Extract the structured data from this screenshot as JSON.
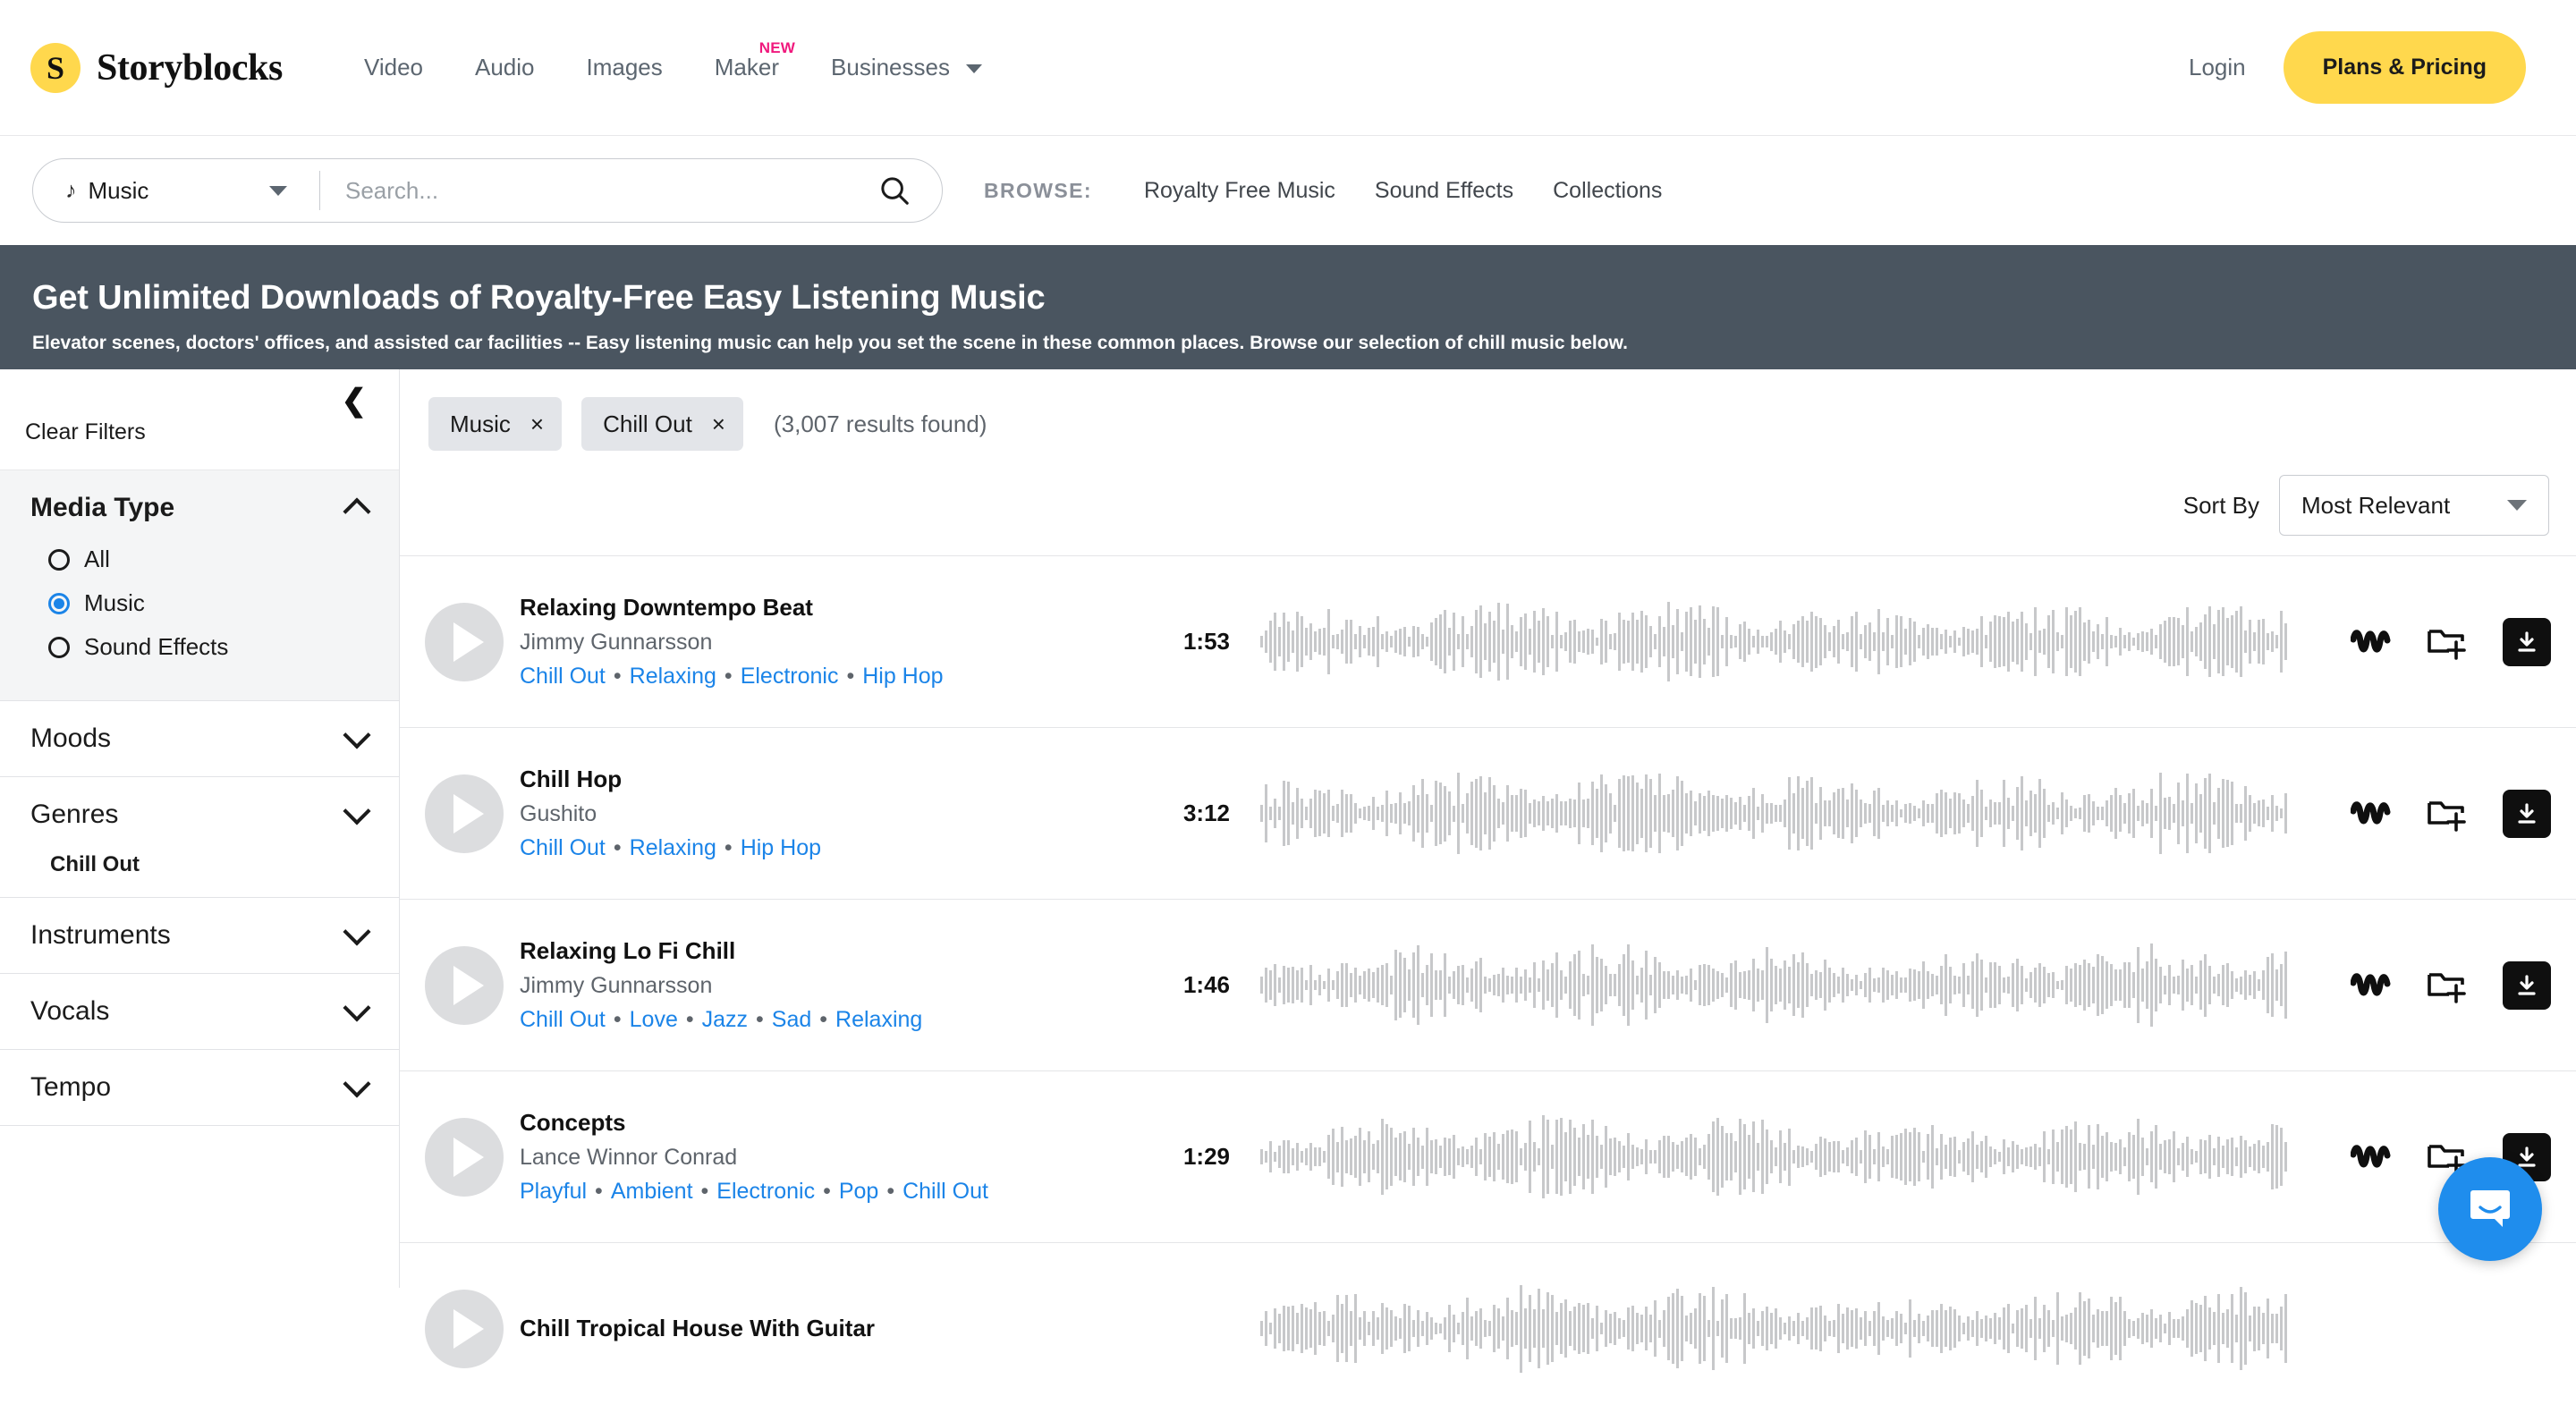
{
  "header": {
    "brand": {
      "mark": "S",
      "name": "Storyblocks"
    },
    "nav": [
      {
        "label": "Video",
        "badge": null
      },
      {
        "label": "Audio",
        "badge": null
      },
      {
        "label": "Images",
        "badge": null
      },
      {
        "label": "Maker",
        "badge": "NEW"
      },
      {
        "label": "Businesses",
        "badge": null,
        "caret": true
      }
    ],
    "login_label": "Login",
    "plans_label": "Plans & Pricing",
    "accent_yellow": "#ffd84d",
    "badge_pink": "#f0197d"
  },
  "search": {
    "type_label": "Music",
    "note_icon": "music-note-icon",
    "placeholder": "Search...",
    "value": "",
    "submit_icon": "search-icon"
  },
  "browse": {
    "label": "BROWSE:",
    "links": [
      "Royalty Free Music",
      "Sound Effects",
      "Collections"
    ]
  },
  "hero": {
    "title": "Get Unlimited Downloads of Royalty-Free Easy Listening Music",
    "subtitle": "Elevator scenes, doctors' offices, and assisted car facilities -- Easy listening music can help you set the scene in these common places. Browse our selection of chill music below.",
    "bg": "#4a5560"
  },
  "sidebar": {
    "collapse_icon": "chevron-left-icon",
    "clear_filters": "Clear Filters",
    "sections": [
      {
        "title": "Media Type",
        "expanded": true,
        "options": [
          {
            "label": "All",
            "selected": false
          },
          {
            "label": "Music",
            "selected": true
          },
          {
            "label": "Sound Effects",
            "selected": false
          }
        ]
      },
      {
        "title": "Moods",
        "expanded": false,
        "value": null
      },
      {
        "title": "Genres",
        "expanded": false,
        "value": "Chill Out"
      },
      {
        "title": "Instruments",
        "expanded": false,
        "value": null
      },
      {
        "title": "Vocals",
        "expanded": false,
        "value": null
      },
      {
        "title": "Tempo",
        "expanded": false,
        "value": null
      }
    ],
    "radio_accent": "#1b84e8"
  },
  "results": {
    "chips": [
      {
        "label": "Music",
        "remove": "×"
      },
      {
        "label": "Chill Out",
        "remove": "×"
      }
    ],
    "count_text": "(3,007 results found)",
    "sort_label": "Sort By",
    "sort_value": "Most Relevant",
    "tracks": [
      {
        "title": "Relaxing Downtempo Beat",
        "artist": "Jimmy Gunnarsson",
        "tags": [
          "Chill Out",
          "Relaxing",
          "Electronic",
          "Hip Hop"
        ],
        "duration": "1:53",
        "actions": [
          "maker-waveform-icon",
          "add-to-folder-icon",
          "download-icon"
        ]
      },
      {
        "title": "Chill Hop",
        "artist": "Gushito",
        "tags": [
          "Chill Out",
          "Relaxing",
          "Hip Hop"
        ],
        "duration": "3:12",
        "actions": [
          "maker-waveform-icon",
          "add-to-folder-icon",
          "download-icon"
        ]
      },
      {
        "title": "Relaxing Lo Fi Chill",
        "artist": "Jimmy Gunnarsson",
        "tags": [
          "Chill Out",
          "Love",
          "Jazz",
          "Sad",
          "Relaxing"
        ],
        "duration": "1:46",
        "actions": [
          "maker-waveform-icon",
          "add-to-folder-icon",
          "download-icon"
        ]
      },
      {
        "title": "Concepts",
        "artist": "Lance Winnor Conrad",
        "tags": [
          "Playful",
          "Ambient",
          "Electronic",
          "Pop",
          "Chill Out"
        ],
        "duration": "1:29",
        "actions": [
          "maker-waveform-icon",
          "add-to-folder-icon",
          "download-icon"
        ]
      },
      {
        "title": "Chill Tropical House With Guitar",
        "artist": "",
        "tags": [],
        "duration": "",
        "actions": []
      }
    ],
    "link_color": "#1b84e8"
  },
  "chat": {
    "icon": "chat-bubble-icon",
    "color": "#1f8ded"
  }
}
